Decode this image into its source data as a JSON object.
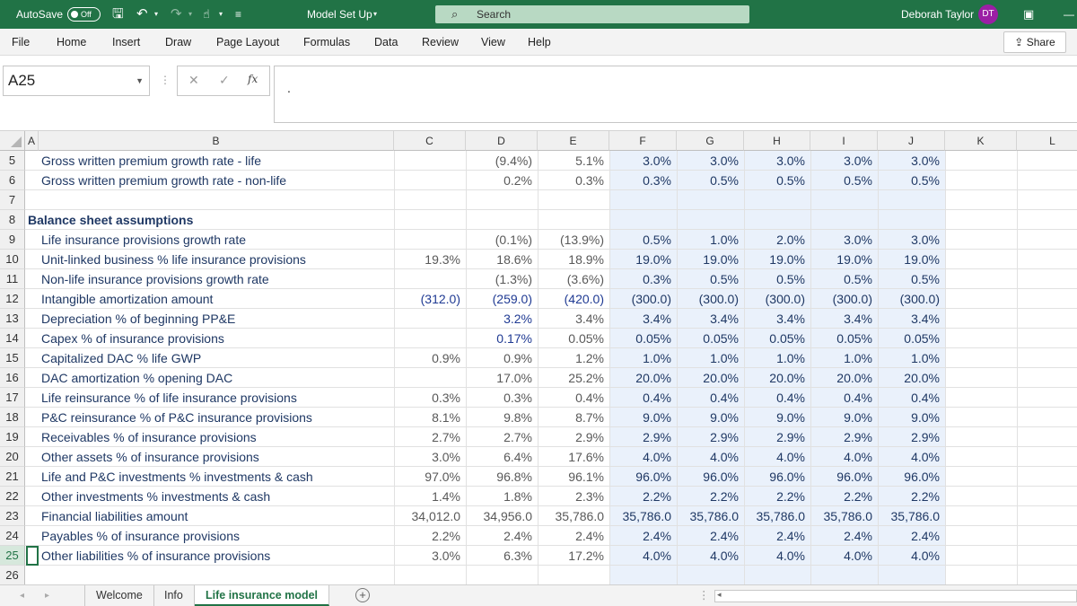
{
  "titlebar": {
    "autosave_label": "AutoSave",
    "autosave_state": "Off",
    "file_title": "Model Set Up",
    "search_placeholder": "Search",
    "user_name": "Deborah Taylor",
    "user_initials": "DT"
  },
  "ribbon": {
    "tabs": [
      "File",
      "Home",
      "Insert",
      "Draw",
      "Page Layout",
      "Formulas",
      "Data",
      "Review",
      "View",
      "Help"
    ],
    "share_label": "Share"
  },
  "formula_bar": {
    "name_box": "A25",
    "fx": "fx",
    "cancel": "✕",
    "enter": "✓",
    "content": "."
  },
  "columns": [
    "A",
    "B",
    "C",
    "D",
    "E",
    "F",
    "G",
    "H",
    "I",
    "J",
    "K",
    "L"
  ],
  "rows": [
    {
      "num": "5",
      "label": "Gross written premium growth rate - life",
      "style": "lbl",
      "c": "",
      "d": "(9.4%)",
      "e": "5.1%",
      "f": "3.0%",
      "g": "3.0%",
      "h": "3.0%",
      "i": "3.0%",
      "j": "3.0%"
    },
    {
      "num": "6",
      "label": "Gross written premium growth rate - non-life",
      "style": "lbl",
      "c": "",
      "d": "0.2%",
      "e": "0.3%",
      "f": "0.3%",
      "g": "0.5%",
      "h": "0.5%",
      "i": "0.5%",
      "j": "0.5%"
    },
    {
      "num": "7",
      "label": "",
      "style": "lbl",
      "c": "",
      "d": "",
      "e": "",
      "f": "",
      "g": "",
      "h": "",
      "i": "",
      "j": ""
    },
    {
      "num": "8",
      "label": "Balance sheet assumptions",
      "style": "hdr",
      "c": "",
      "d": "",
      "e": "",
      "f": "",
      "g": "",
      "h": "",
      "i": "",
      "j": ""
    },
    {
      "num": "9",
      "label": "Life insurance provisions growth rate",
      "style": "lbl",
      "c": "",
      "d": "(0.1%)",
      "e": "(13.9%)",
      "f": "0.5%",
      "g": "1.0%",
      "h": "2.0%",
      "i": "3.0%",
      "j": "3.0%"
    },
    {
      "num": "10",
      "label": "Unit-linked business % life insurance provisions",
      "style": "lbl",
      "c": "19.3%",
      "d": "18.6%",
      "e": "18.9%",
      "f": "19.0%",
      "g": "19.0%",
      "h": "19.0%",
      "i": "19.0%",
      "j": "19.0%"
    },
    {
      "num": "11",
      "label": "Non-life insurance provisions growth rate",
      "style": "lbl",
      "c": "",
      "d": "(1.3%)",
      "e": "(3.6%)",
      "f": "0.3%",
      "g": "0.5%",
      "h": "0.5%",
      "i": "0.5%",
      "j": "0.5%"
    },
    {
      "num": "12",
      "label": "Intangible amortization amount",
      "style": "lbl",
      "c": "(312.0)",
      "d": "(259.0)",
      "e": "(420.0)",
      "f": "(300.0)",
      "g": "(300.0)",
      "h": "(300.0)",
      "i": "(300.0)",
      "j": "(300.0)",
      "blue": true
    },
    {
      "num": "13",
      "label": "Depreciation % of beginning PP&E",
      "style": "lbl",
      "c": "",
      "d": "3.2%",
      "e": "3.4%",
      "f": "3.4%",
      "g": "3.4%",
      "h": "3.4%",
      "i": "3.4%",
      "j": "3.4%",
      "blue_d": true
    },
    {
      "num": "14",
      "label": "Capex % of insurance provisions",
      "style": "lbl",
      "c": "",
      "d": "0.17%",
      "e": "0.05%",
      "f": "0.05%",
      "g": "0.05%",
      "h": "0.05%",
      "i": "0.05%",
      "j": "0.05%",
      "blue_d": true
    },
    {
      "num": "15",
      "label": "Capitalized DAC % life GWP",
      "style": "lbl",
      "c": "0.9%",
      "d": "0.9%",
      "e": "1.2%",
      "f": "1.0%",
      "g": "1.0%",
      "h": "1.0%",
      "i": "1.0%",
      "j": "1.0%"
    },
    {
      "num": "16",
      "label": "DAC amortization % opening DAC",
      "style": "lbl",
      "c": "",
      "d": "17.0%",
      "e": "25.2%",
      "f": "20.0%",
      "g": "20.0%",
      "h": "20.0%",
      "i": "20.0%",
      "j": "20.0%"
    },
    {
      "num": "17",
      "label": "Life reinsurance % of life insurance provisions",
      "style": "lbl",
      "c": "0.3%",
      "d": "0.3%",
      "e": "0.4%",
      "f": "0.4%",
      "g": "0.4%",
      "h": "0.4%",
      "i": "0.4%",
      "j": "0.4%"
    },
    {
      "num": "18",
      "label": "P&C reinsurance % of P&C insurance provisions",
      "style": "lbl",
      "c": "8.1%",
      "d": "9.8%",
      "e": "8.7%",
      "f": "9.0%",
      "g": "9.0%",
      "h": "9.0%",
      "i": "9.0%",
      "j": "9.0%"
    },
    {
      "num": "19",
      "label": "Receivables % of insurance provisions",
      "style": "lbl",
      "c": "2.7%",
      "d": "2.7%",
      "e": "2.9%",
      "f": "2.9%",
      "g": "2.9%",
      "h": "2.9%",
      "i": "2.9%",
      "j": "2.9%"
    },
    {
      "num": "20",
      "label": "Other assets % of insurance provisions",
      "style": "lbl",
      "c": "3.0%",
      "d": "6.4%",
      "e": "17.6%",
      "f": "4.0%",
      "g": "4.0%",
      "h": "4.0%",
      "i": "4.0%",
      "j": "4.0%"
    },
    {
      "num": "21",
      "label": "Life and P&C investments % investments & cash",
      "style": "lbl",
      "c": "97.0%",
      "d": "96.8%",
      "e": "96.1%",
      "f": "96.0%",
      "g": "96.0%",
      "h": "96.0%",
      "i": "96.0%",
      "j": "96.0%"
    },
    {
      "num": "22",
      "label": "Other investments % investments & cash",
      "style": "lbl",
      "c": "1.4%",
      "d": "1.8%",
      "e": "2.3%",
      "f": "2.2%",
      "g": "2.2%",
      "h": "2.2%",
      "i": "2.2%",
      "j": "2.2%"
    },
    {
      "num": "23",
      "label": "Financial liabilities amount",
      "style": "lbl",
      "c": "34,012.0",
      "d": "34,956.0",
      "e": "35,786.0",
      "f": "35,786.0",
      "g": "35,786.0",
      "h": "35,786.0",
      "i": "35,786.0",
      "j": "35,786.0"
    },
    {
      "num": "24",
      "label": "Payables % of insurance provisions",
      "style": "lbl",
      "c": "2.2%",
      "d": "2.4%",
      "e": "2.4%",
      "f": "2.4%",
      "g": "2.4%",
      "h": "2.4%",
      "i": "2.4%",
      "j": "2.4%"
    },
    {
      "num": "25",
      "label": "Other liabilities % of insurance provisions",
      "style": "lbl",
      "c": "3.0%",
      "d": "6.3%",
      "e": "17.2%",
      "f": "4.0%",
      "g": "4.0%",
      "h": "4.0%",
      "i": "4.0%",
      "j": "4.0%"
    },
    {
      "num": "26",
      "label": "",
      "style": "lbl",
      "c": "",
      "d": "",
      "e": "",
      "f": "",
      "g": "",
      "h": "",
      "i": "",
      "j": ""
    }
  ],
  "sheets": {
    "tabs": [
      "Welcome",
      "Info",
      "Life insurance model"
    ],
    "active": "Life insurance model",
    "add": "+"
  },
  "colors": {
    "accent": "#217346",
    "label_text": "#1f3864",
    "input_blue": "#1f3a93",
    "projection_fill": "#eaf1fb"
  }
}
